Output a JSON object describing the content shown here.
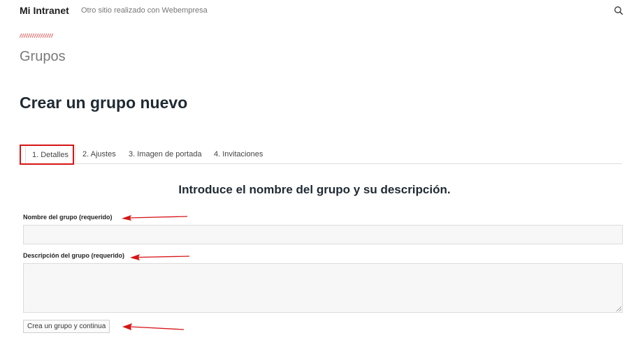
{
  "header": {
    "site_title": "Mi Intranet",
    "tagline": "Otro sitio realizado con Webempresa",
    "search_icon": "search-icon"
  },
  "page": {
    "heading": "Grupos",
    "create_title": "Crear un grupo nuevo"
  },
  "tabs": [
    {
      "label": "1. Detalles",
      "active": true
    },
    {
      "label": "2. Ajustes",
      "active": false
    },
    {
      "label": "3. Imagen de portada",
      "active": false
    },
    {
      "label": "4. Invitaciones",
      "active": false
    }
  ],
  "form": {
    "heading": "Introduce el nombre del grupo y su descripción.",
    "name_label": "Nombre del grupo (requerido)",
    "name_value": "",
    "desc_label": "Descripción del grupo (requerido)",
    "desc_value": "",
    "submit_label": "Crea un grupo y continua"
  },
  "colors": {
    "annotation": "#d61515",
    "input_bg": "#f7f7f7",
    "border": "#dcdcdc"
  }
}
